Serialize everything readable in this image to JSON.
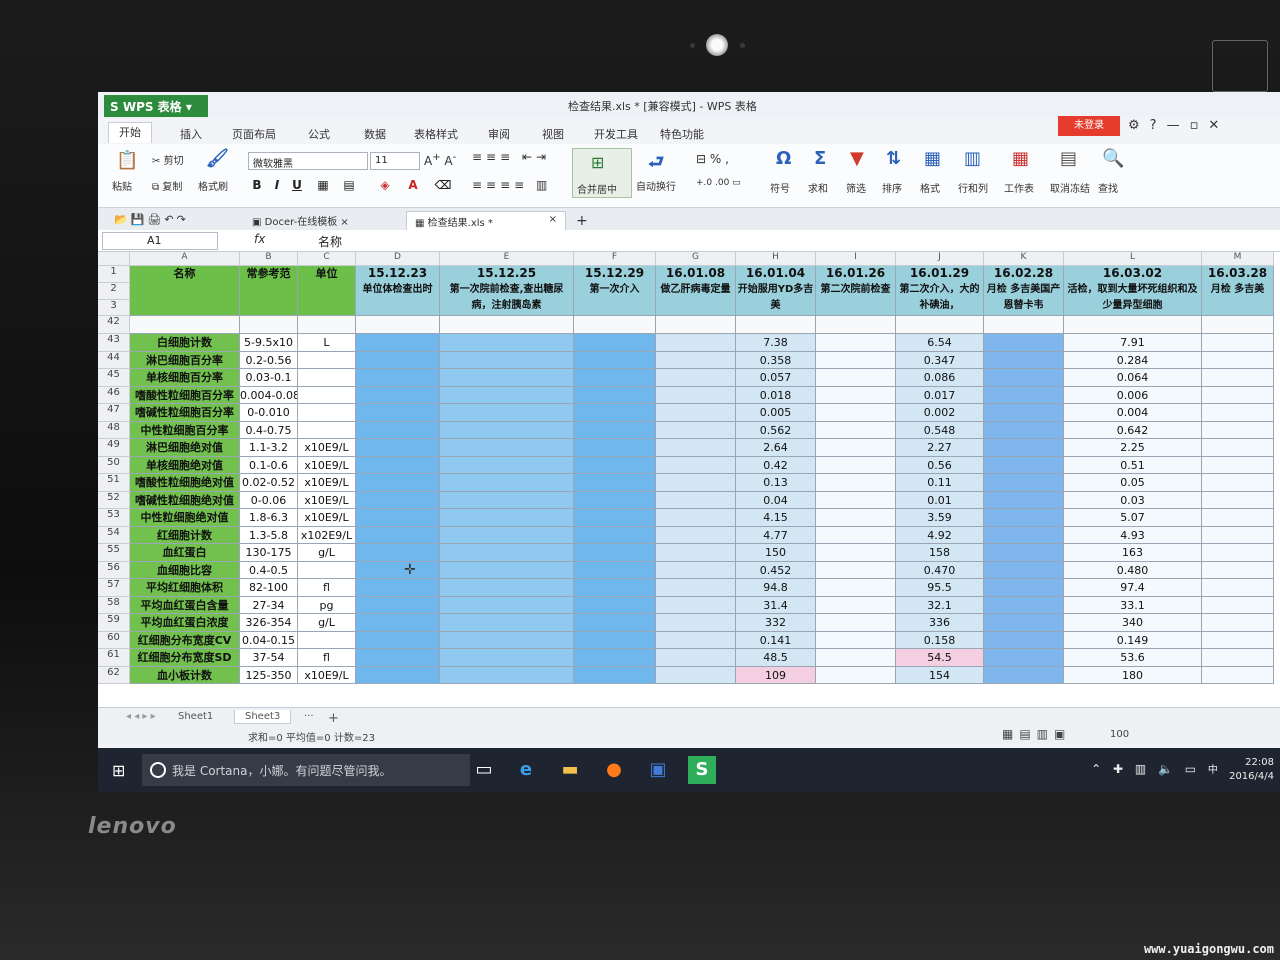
{
  "app": {
    "name": "WPS 表格",
    "doc_title": "检查结果.xls * [兼容模式] - WPS 表格",
    "login": "未登录"
  },
  "menu": [
    "开始",
    "插入",
    "页面布局",
    "公式",
    "数据",
    "表格样式",
    "审阅",
    "视图",
    "开发工具",
    "特色功能"
  ],
  "ribbon": {
    "paste": "粘贴",
    "cut": "剪切",
    "copy": "复制",
    "format_painter": "格式刷",
    "font_name": "微软雅黑",
    "font_size": "11",
    "merge": "合并居中",
    "wrap": "自动换行",
    "symbol": "符号",
    "sum": "求和",
    "filter": "筛选",
    "sort": "排序",
    "format": "格式",
    "rowcol": "行和列",
    "sheet": "工作表",
    "freeze": "取消冻结",
    "find": "查找"
  },
  "tabs": {
    "docer": "Docer-在线模板",
    "file": "检查结果.xls *"
  },
  "formula_bar": {
    "cell_ref": "A1",
    "fx": "fx",
    "content": "名称"
  },
  "columns": [
    "A",
    "B",
    "C",
    "D",
    "E",
    "F",
    "G",
    "H",
    "I",
    "J",
    "K",
    "L",
    "M"
  ],
  "header": {
    "name": "名称",
    "range": "常参考范",
    "unit": "单位",
    "dates": [
      {
        "date": "15.12.23",
        "desc": "单位体检查出时"
      },
      {
        "date": "15.12.25",
        "desc": "第一次院前检查,查出糖尿病，注射胰岛素"
      },
      {
        "date": "15.12.29",
        "desc": "第一次介入"
      },
      {
        "date": "16.01.08",
        "desc": "做乙肝病毒定量"
      },
      {
        "date": "16.01.04",
        "desc": "开始服用YD多吉美"
      },
      {
        "date": "16.01.26",
        "desc": "第二次院前检查"
      },
      {
        "date": "16.01.29",
        "desc": "第二次介入，大的补碘油，"
      },
      {
        "date": "16.02.28",
        "desc": "月检 多吉美国产恩替卡韦"
      },
      {
        "date": "16.03.02",
        "desc": "活检，取到大量坏死组织和及少量异型细胞"
      },
      {
        "date": "16.03.28",
        "desc": "月检 多吉美"
      }
    ]
  },
  "header_rows": [
    "1",
    "2",
    "3",
    "42"
  ],
  "rows": [
    {
      "num": "43",
      "name": "白细胞计数",
      "range": "5-9.5x10",
      "unit": "L",
      "i": "7.38",
      "k": "6.54",
      "m": "7.91"
    },
    {
      "num": "44",
      "name": "淋巴细胞百分率",
      "range": "0.2-0.56",
      "unit": "",
      "i": "0.358",
      "k": "0.347",
      "m": "0.284"
    },
    {
      "num": "45",
      "name": "单核细胞百分率",
      "range": "0.03-0.1",
      "unit": "",
      "i": "0.057",
      "k": "0.086",
      "m": "0.064"
    },
    {
      "num": "46",
      "name": "嗜酸性粒细胞百分率",
      "range": "0.004-0.08",
      "unit": "",
      "i": "0.018",
      "k": "0.017",
      "m": "0.006"
    },
    {
      "num": "47",
      "name": "嗜碱性粒细胞百分率",
      "range": "0-0.010",
      "unit": "",
      "i": "0.005",
      "k": "0.002",
      "m": "0.004"
    },
    {
      "num": "48",
      "name": "中性粒细胞百分率",
      "range": "0.4-0.75",
      "unit": "",
      "i": "0.562",
      "k": "0.548",
      "m": "0.642"
    },
    {
      "num": "49",
      "name": "淋巴细胞绝对值",
      "range": "1.1-3.2",
      "unit": "x10E9/L",
      "i": "2.64",
      "k": "2.27",
      "m": "2.25"
    },
    {
      "num": "50",
      "name": "单核细胞绝对值",
      "range": "0.1-0.6",
      "unit": "x10E9/L",
      "i": "0.42",
      "k": "0.56",
      "m": "0.51"
    },
    {
      "num": "51",
      "name": "嗜酸性粒细胞绝对值",
      "range": "0.02-0.52",
      "unit": "x10E9/L",
      "i": "0.13",
      "k": "0.11",
      "m": "0.05"
    },
    {
      "num": "52",
      "name": "嗜碱性粒细胞绝对值",
      "range": "0-0.06",
      "unit": "x10E9/L",
      "i": "0.04",
      "k": "0.01",
      "m": "0.03"
    },
    {
      "num": "53",
      "name": "中性粒细胞绝对值",
      "range": "1.8-6.3",
      "unit": "x10E9/L",
      "i": "4.15",
      "k": "3.59",
      "m": "5.07"
    },
    {
      "num": "54",
      "name": "红细胞计数",
      "range": "1.3-5.8",
      "unit": "x102E9/L",
      "i": "4.77",
      "k": "4.92",
      "m": "4.93"
    },
    {
      "num": "55",
      "name": "血红蛋白",
      "range": "130-175",
      "unit": "g/L",
      "i": "150",
      "k": "158",
      "m": "163"
    },
    {
      "num": "56",
      "name": "血细胞比容",
      "range": "0.4-0.5",
      "unit": "",
      "i": "0.452",
      "k": "0.470",
      "m": "0.480"
    },
    {
      "num": "57",
      "name": "平均红细胞体积",
      "range": "82-100",
      "unit": "fl",
      "i": "94.8",
      "k": "95.5",
      "m": "97.4"
    },
    {
      "num": "58",
      "name": "平均血红蛋白含量",
      "range": "27-34",
      "unit": "pg",
      "i": "31.4",
      "k": "32.1",
      "m": "33.1"
    },
    {
      "num": "59",
      "name": "平均血红蛋白浓度",
      "range": "326-354",
      "unit": "g/L",
      "i": "332",
      "k": "336",
      "m": "340"
    },
    {
      "num": "60",
      "name": "红细胞分布宽度CV",
      "range": "0.04-0.15",
      "unit": "",
      "i": "0.141",
      "k": "0.158",
      "m": "0.149"
    },
    {
      "num": "61",
      "name": "红细胞分布宽度SD",
      "range": "37-54",
      "unit": "fl",
      "i": "48.5",
      "k": "54.5",
      "m": "53.6"
    },
    {
      "num": "62",
      "name": "血小板计数",
      "range": "125-350",
      "unit": "x10E9/L",
      "i": "109",
      "k": "154",
      "m": "180"
    }
  ],
  "sheets": [
    "Sheet1",
    "Sheet3"
  ],
  "status": "求和=0  平均值=0  计数=23",
  "zoom": "100",
  "taskbar": {
    "cortana": "我是 Cortana，小娜。有问题尽管问我。",
    "time": "22:08",
    "date": "2016/4/4",
    "ime": "中"
  },
  "brand": "lenovo",
  "watermark": "www.yuaigongwu.com"
}
